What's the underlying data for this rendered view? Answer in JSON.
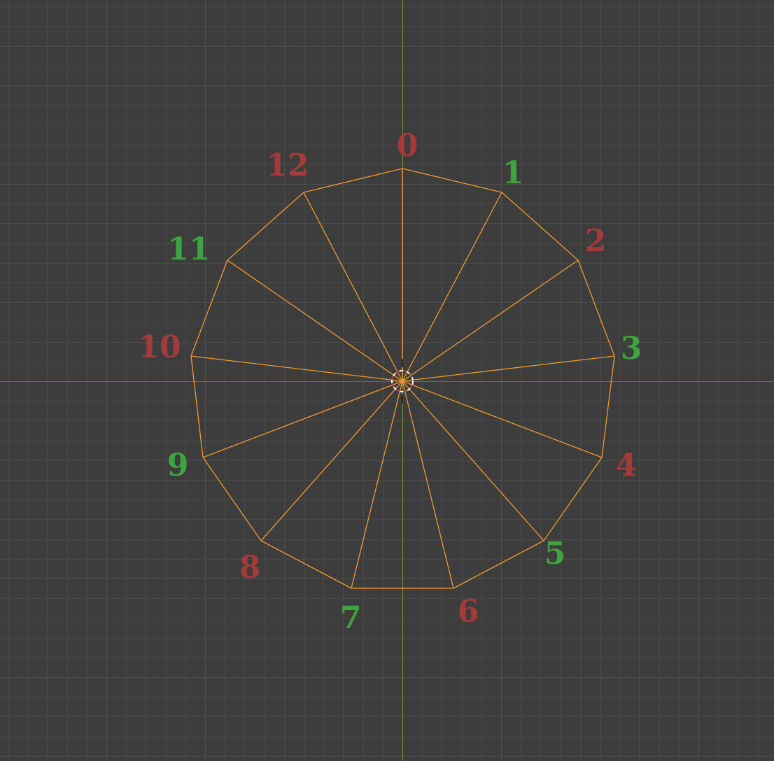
{
  "viewport": {
    "background_color": "#3d3d3d",
    "grid_minor_color": "#4a4a4a",
    "grid_major_color": "#505050",
    "x_axis_color": "#b34747",
    "y_axis_color": "#6f9a3c",
    "mesh_edge_color": "#f39a2e",
    "origin_marker_color": "#ffffff"
  },
  "mesh": {
    "type": "fan-triangulated 13-vertex polygon",
    "selected": true
  },
  "vertex_labels": [
    {
      "text": "0",
      "color": "#a53a3a"
    },
    {
      "text": "1",
      "color": "#3ea53e"
    },
    {
      "text": "2",
      "color": "#a53a3a"
    },
    {
      "text": "3",
      "color": "#3ea53e"
    },
    {
      "text": "4",
      "color": "#a53a3a"
    },
    {
      "text": "5",
      "color": "#3ea53e"
    },
    {
      "text": "6",
      "color": "#a53a3a"
    },
    {
      "text": "7",
      "color": "#3ea53e"
    },
    {
      "text": "8",
      "color": "#a53a3a"
    },
    {
      "text": "9",
      "color": "#3ea53e"
    },
    {
      "text": "10",
      "color": "#a53a3a"
    },
    {
      "text": "11",
      "color": "#3ea53e"
    },
    {
      "text": "12",
      "color": "#a53a3a"
    }
  ]
}
